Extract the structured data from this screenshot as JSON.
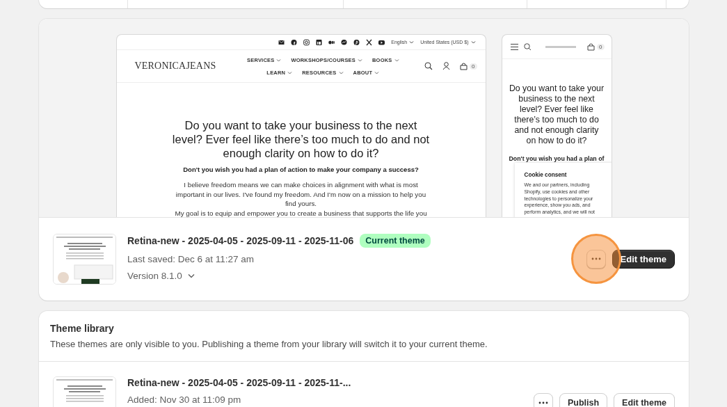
{
  "current_theme": {
    "preview": {
      "desktop": {
        "top_links": [
          "English",
          "United States (USD $)"
        ],
        "logo": "VERONICAJEANS",
        "nav_rows": [
          {
            "items": [
              "SERVICES",
              "WORKSHOPS/COURSES",
              "BOOKS"
            ]
          },
          {
            "items": [
              "LEARN",
              "RESOURCES",
              "ABOUT"
            ]
          }
        ],
        "cart_count": "0",
        "headline": "Do you want to take your business to the next level? Ever feel like there’s too much to do and not enough clarity on how to do it?",
        "subheadline": "Don't you wish you had a plan of action to make your company a success?",
        "paragraphs": [
          "I believe freedom means we can make choices in alignment with what is most important in our lives. I've found my freedom. And I'm now on a mission to help you find yours.",
          "My goal is to equip and empower you to create a business that supports the life you"
        ]
      },
      "mobile": {
        "cart_count": "0",
        "headline": "Do you want to take your business to the next level? Ever feel like there’s too much to do and not enough clarity on how to do it?",
        "subheadline": "Don't you wish you had a plan of",
        "cookie": {
          "title": "Cookie consent",
          "text": "We and our partners, including Shopify, use cookies and other technologies to personalize your experience, show you ads, and perform analytics, and we will not"
        }
      }
    },
    "name": "Retina-new - 2025-04-05 - 2025-09-11 - 2025-11-06",
    "badge": "Current theme",
    "last_saved": "Last saved: Dec 6 at 11:27 am",
    "version": "Version 8.1.0",
    "more_highlighted": true,
    "edit_button": "Edit theme"
  },
  "library": {
    "title": "Theme library",
    "description": "These themes are only visible to you. Publishing a theme from your library will switch it to your current theme.",
    "themes": [
      {
        "name": "Retina-new - 2025-04-05 - 2025-09-11 - 2025-11-...",
        "added": "Added: Nov 30 at 11:09 pm",
        "buttons": [
          "Publish",
          "Edit theme"
        ]
      }
    ]
  }
}
